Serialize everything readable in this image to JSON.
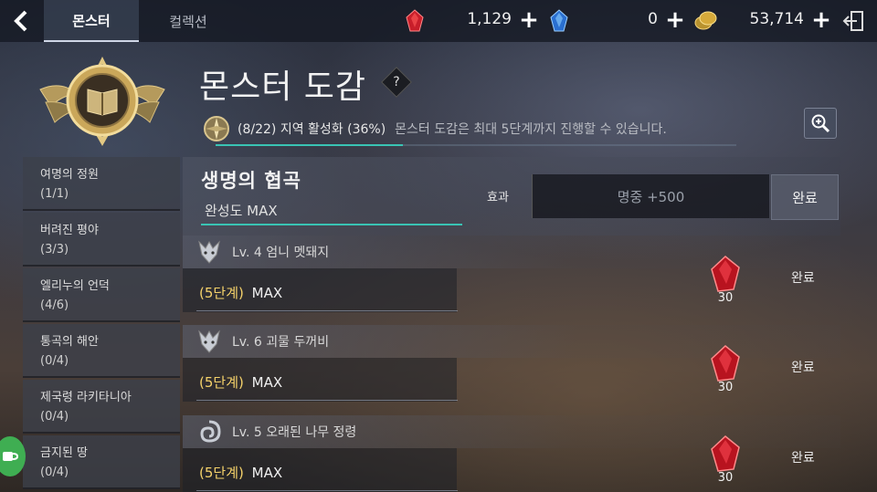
{
  "header": {
    "tabs": [
      {
        "label": "몬스터",
        "active": true
      },
      {
        "label": "컬렉션",
        "active": false
      }
    ],
    "currency": {
      "red_gem": "1,129",
      "blue_gem": "0",
      "gold": "53,714"
    },
    "icons": [
      "back-arrow-icon",
      "red-gem-icon",
      "blue-gem-icon",
      "gold-coin-icon",
      "exit-icon",
      "plus-icon"
    ]
  },
  "page": {
    "title": "몬스터 도감",
    "help_glyph": "?",
    "region_status": "(8/22) 지역 활성화 (36%)",
    "region_progress_percent": 36,
    "description": "몬스터 도감은 최대 5단계까지 진행할 수 있습니다."
  },
  "sidebar": {
    "items": [
      {
        "name": "여명의 정원",
        "count": "(1/1)"
      },
      {
        "name": "버려진 평야",
        "count": "(3/3)"
      },
      {
        "name": "엘리누의 언덕",
        "count": "(4/6)"
      },
      {
        "name": "통곡의 해안",
        "count": "(0/4)"
      },
      {
        "name": "제국령 라키타니아",
        "count": "(0/4)"
      },
      {
        "name": "금지된 땅",
        "count": "(0/4)"
      }
    ]
  },
  "region": {
    "name": "생명의 협곡",
    "completion": "완성도  MAX",
    "effect_label": "효과",
    "effect_value": "명중 +500",
    "complete_label": "완료"
  },
  "monsters": [
    {
      "name": "Lv. 4  엄니 멧돼지",
      "stage": "(5단계)",
      "max": "MAX",
      "reward": "30",
      "status": "완료",
      "icon": "beast-icon"
    },
    {
      "name": "Lv. 6  괴물 두꺼비",
      "stage": "(5단계)",
      "max": "MAX",
      "reward": "30",
      "status": "완료",
      "icon": "beast-icon"
    },
    {
      "name": "Lv. 5  오래된 나무 정령",
      "stage": "(5단계)",
      "max": "MAX",
      "reward": "30",
      "status": "완료",
      "icon": "spirit-icon"
    }
  ],
  "colors": {
    "accent_teal": "#39c4b4",
    "stage_yellow": "#f5d26a",
    "chat_green": "#3fae52"
  }
}
